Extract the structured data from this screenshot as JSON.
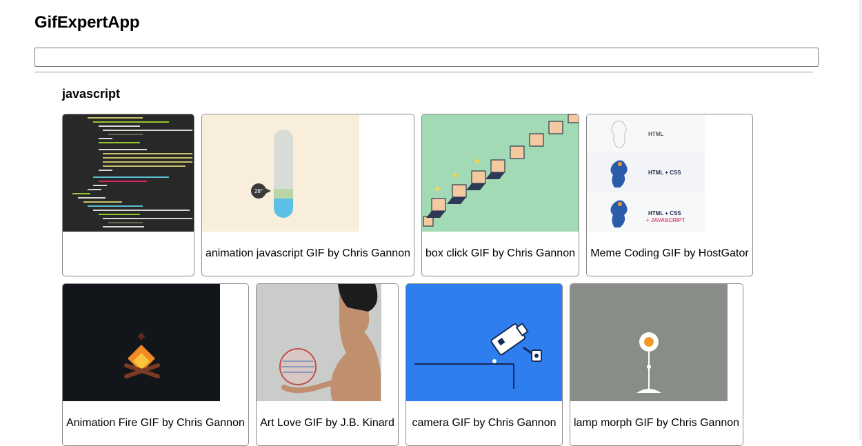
{
  "app": {
    "title": "GifExpertApp"
  },
  "search": {
    "value": "",
    "placeholder": ""
  },
  "category": {
    "title": "javascript",
    "gifs": [
      {
        "title": ""
      },
      {
        "title": "animation javascript GIF by Chris Gannon"
      },
      {
        "title": "box click GIF by Chris Gannon"
      },
      {
        "title": "Meme Coding GIF by HostGator"
      },
      {
        "title": "Animation Fire GIF by Chris Gannon"
      },
      {
        "title": "Art Love GIF by J.B. Kinard"
      },
      {
        "title": "camera GIF by Chris Gannon"
      },
      {
        "title": "lamp morph GIF by Chris Gannon"
      }
    ]
  },
  "thermometer": {
    "reading": "28°"
  },
  "meme": {
    "step1": "HTML",
    "step2": "HTML + CSS",
    "step3a": "HTML + CSS",
    "step3b": "+ JAVASCRIPT"
  }
}
